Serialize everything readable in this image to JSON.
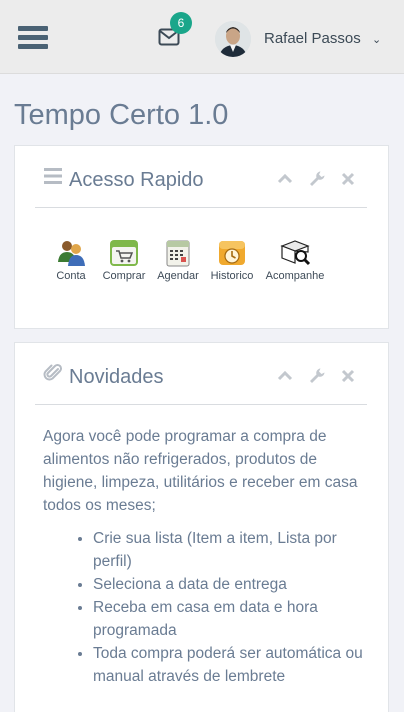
{
  "header": {
    "notification_count": "6",
    "user_name": "Rafael Passos",
    "user_caret": "⌄"
  },
  "page": {
    "title": "Tempo Certo 1.0"
  },
  "quick_access": {
    "title": "Acesso Rapido",
    "items": [
      {
        "label": "Conta",
        "icon": "users-icon"
      },
      {
        "label": "Comprar",
        "icon": "cart-icon"
      },
      {
        "label": "Agendar",
        "icon": "calendar-icon"
      },
      {
        "label": "Historico",
        "icon": "history-icon"
      },
      {
        "label": "Acompanhe",
        "icon": "track-icon"
      }
    ]
  },
  "news": {
    "title": "Novidades",
    "intro": "Agora você pode programar a compra de alimentos não refrigerados, produtos de higiene, limpeza, utilitários e receber em casa todos os meses;",
    "bullets": [
      "Crie sua lista (Item a item, Lista por perfil)",
      "Seleciona a data de entrega",
      "Receba em casa em data e hora programada",
      "Toda compra poderá ser automática ou manual através de lembrete"
    ]
  },
  "colors": {
    "badge": "#1aa68a",
    "accent": "#6a7c93",
    "topbar": "#ececec"
  }
}
